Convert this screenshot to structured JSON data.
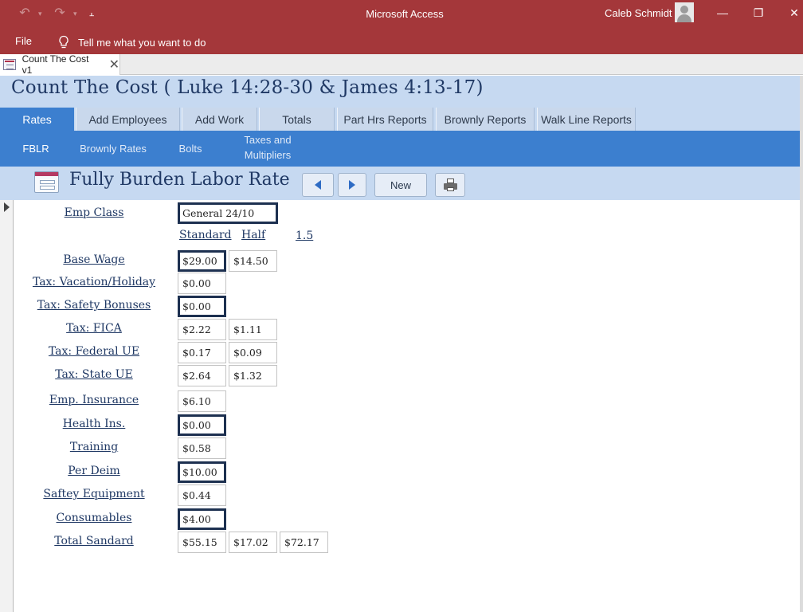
{
  "window": {
    "app_title": "Microsoft Access",
    "user_name": "Caleb Schmidt",
    "menu_file": "File",
    "tell_me": "Tell me what you want to do"
  },
  "document_tab": {
    "label": "Count The Cost v1",
    "close_glyph": "✕"
  },
  "form": {
    "title": "Count The Cost ( Luke 14:28-30 & James  4:13-17)",
    "tabs": [
      "Rates",
      "Add Employees",
      "Add Work",
      "Totals",
      "Part Hrs Reports",
      "Brownly Reports",
      "Walk Line Reports"
    ],
    "active_tab": "Rates",
    "subtabs": [
      "FBLR",
      "Brownly Rates",
      "Bolts",
      "Taxes and Multipliers"
    ],
    "active_subtab": "FBLR"
  },
  "record": {
    "title": "Fully Burden Labor Rate",
    "buttons": {
      "new_label": "New"
    },
    "emp_class_label": "Emp Class",
    "emp_class_value": "General 24/10",
    "columns": [
      "Standard",
      "Half",
      "1.5"
    ],
    "rows": [
      {
        "label": "Base Wage",
        "standard": "$29.00",
        "half": "$14.50"
      },
      {
        "label": "Tax: Vacation/Holiday",
        "standard": "$0.00"
      },
      {
        "label": "Tax: Safety Bonuses",
        "standard": "$0.00"
      },
      {
        "label": "Tax: FICA",
        "standard": "$2.22",
        "half": "$1.11"
      },
      {
        "label": "Tax: Federal UE",
        "standard": "$0.17",
        "half": "$0.09"
      },
      {
        "label": "Tax: State UE",
        "standard": "$2.64",
        "half": "$1.32"
      },
      {
        "label": "Emp. Insurance",
        "standard": "$6.10"
      },
      {
        "label": "Health Ins.",
        "standard": "$0.00"
      },
      {
        "label": "Training",
        "standard": "$0.58"
      },
      {
        "label": "Per Deim",
        "standard": "$10.00"
      },
      {
        "label": "Saftey Equipment",
        "standard": "$0.44"
      },
      {
        "label": "Consumables",
        "standard": "$4.00"
      },
      {
        "label": "Total Sandard",
        "standard": "$55.15",
        "half": "$17.02",
        "one_half": "$72.17"
      }
    ]
  },
  "colors": {
    "title_bar": "#a4373a",
    "tab_active": "#3c7fcf",
    "header_band": "#c6d9f1",
    "text_navy": "#1f3864"
  }
}
